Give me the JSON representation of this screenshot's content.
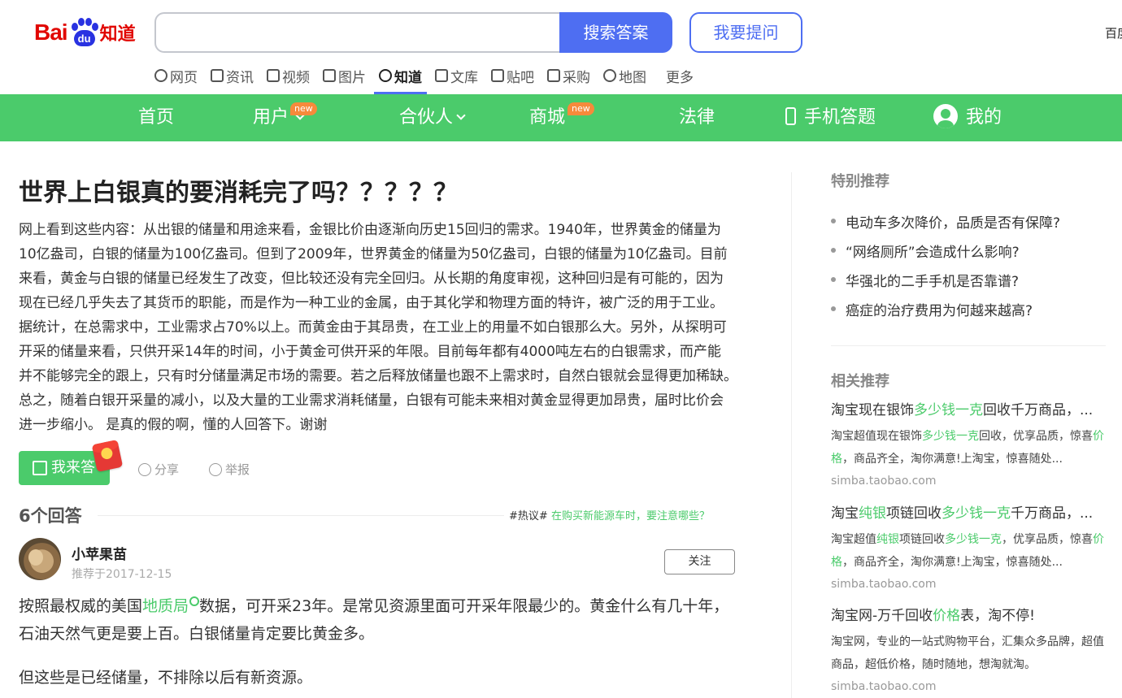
{
  "header": {
    "logo_bai": "Bai",
    "logo_du": "du",
    "logo_zhidao": "知道",
    "search_placeholder": "",
    "search_button": "搜索答案",
    "ask_button": "我要提问",
    "corner_link": "百度"
  },
  "subnav": [
    {
      "label": "网页",
      "icon": "search-icon"
    },
    {
      "label": "资讯",
      "icon": "news-icon"
    },
    {
      "label": "视频",
      "icon": "video-icon"
    },
    {
      "label": "图片",
      "icon": "image-icon"
    },
    {
      "label": "知道",
      "icon": "question-icon",
      "active": true
    },
    {
      "label": "文库",
      "icon": "doc-icon"
    },
    {
      "label": "贴吧",
      "icon": "tieba-icon"
    },
    {
      "label": "采购",
      "icon": "bag-icon"
    },
    {
      "label": "地图",
      "icon": "map-icon"
    },
    {
      "label": "更多"
    }
  ],
  "greennav": {
    "home": "首页",
    "user": "用户",
    "user_badge": "new",
    "partner": "合伙人",
    "mall": "商城",
    "mall_badge": "new",
    "law": "法律",
    "mobile": "手机答题",
    "mine": "我的"
  },
  "question": {
    "title": "世界上白银真的要消耗完了吗？？？？？",
    "body": "网上看到这些内容：从出银的储量和用途来看，金银比价由逐渐向历史15回归的需求。1940年，世界黄金的储量为10亿盎司，白银的储量为100亿盎司。但到了2009年，世界黄金的储量为50亿盎司，白银的储量为10亿盎司。目前来看，黄金与白银的储量已经发生了改变，但比较还没有完全回归。从长期的角度审视，这种回归是有可能的，因为现在已经几乎失去了其货币的职能，而是作为一种工业的金属，由于其化学和物理方面的特许，被广泛的用于工业。据统计，在总需求中，工业需求占70%以上。而黄金由于其昂贵，在工业上的用量不如白银那么大。另外，从探明可开采的储量来看，只供开采14年的时间，小于黄金可供开采的年限。目前每年都有4000吨左右的白银需求，而产能并不能够完全的跟上，只有时分储量满足市场的需要。若之后释放储量也跟不上需求时，自然白银就会显得更加稀缺。　总之，随着白银开采量的减小，以及大量的工业需求消耗储量，白银有可能未来相对黄金显得更加昂贵，届时比价会进一步缩小。 是真的假的啊，懂的人回答下。谢谢",
    "answer_button": "我来答",
    "share": "分享",
    "report": "举报"
  },
  "answers": {
    "count_label": "6个回答",
    "hot_prefix": "#热议#",
    "hot_topic": "在购买新能源车时，要注意哪些？",
    "first": {
      "user": "小苹果苗",
      "meta": "推荐于2017-12-15",
      "follow": "关注",
      "p1_a": "按照最权威的美国",
      "p1_link": "地质局",
      "p1_b": "数据，可开采23年。是常见资源里面可开采年限最少的。黄金什么有几十年，石油天然气更是要上百。白银储量肯定要比黄金多。",
      "p2": "但这些是已经储量，不排除以后有新资源。"
    }
  },
  "sidebar": {
    "special_title": "特别推荐",
    "special": [
      "电动车多次降价，品质是否有保障?",
      "“网络厕所”会造成什么影响?",
      "华强北的二手手机是否靠谱?",
      "癌症的治疗费用为何越来越高?"
    ],
    "related_title": "相关推荐",
    "related": [
      {
        "t_a": "淘宝现在银饰",
        "t_g": "多少钱一克",
        "t_b": "回收千万商品，...",
        "d_a": "淘宝超值现在银饰",
        "d_g1": "多少钱一克",
        "d_b": "回收，优享品质，惊喜",
        "d_g2": "价格",
        "d_c": "，商品齐全，淘你满意!上淘宝，惊喜随处...",
        "url": "simba.taobao.com"
      },
      {
        "t_a": "淘宝",
        "t_g": "纯银",
        "t_b": "项链回收",
        "t_g2": "多少钱一克",
        "t_c": "千万商品，...",
        "d_a": "淘宝超值",
        "d_g1": "纯银",
        "d_b": "项链回收",
        "d_g3": "多少钱一克",
        "d_b2": "，优享品质，惊喜",
        "d_g2": "价格",
        "d_c": "，商品齐全，淘你满意!上淘宝，惊喜随处...",
        "url": "simba.taobao.com"
      },
      {
        "t_a": "淘宝网-万千回收",
        "t_g": "价格",
        "t_b": "表，淘不停!",
        "d": "淘宝网，专业的一站式购物平台，汇集众多品牌，超值商品，超低价格，随时随地，想淘就淘。",
        "url": "simba.taobao.com"
      }
    ]
  },
  "colors": {
    "green": "#4bcb6b",
    "blue": "#4e6ef2",
    "badge": "#f78a3b"
  }
}
